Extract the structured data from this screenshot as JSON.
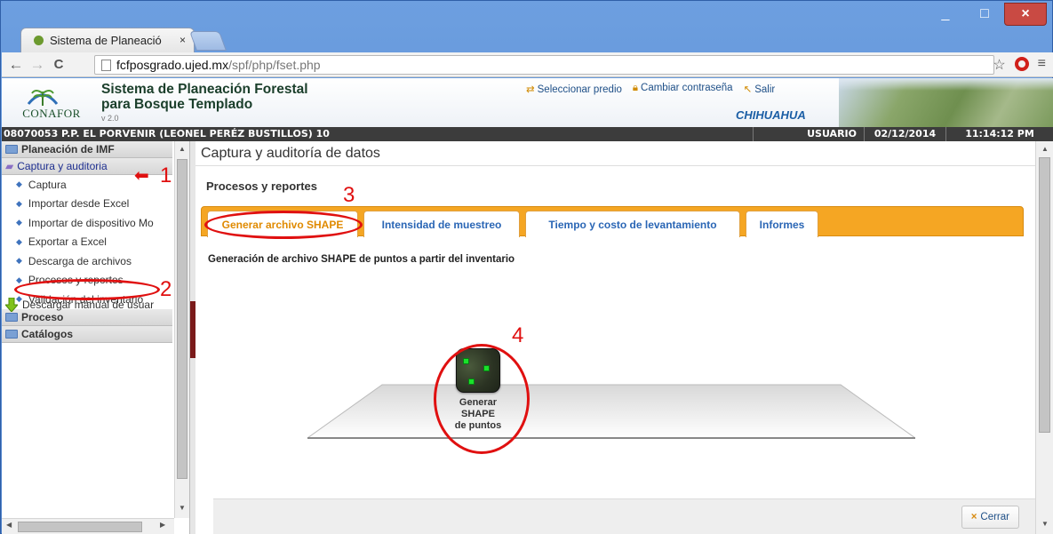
{
  "browser": {
    "tab_title": "Sistema de Planeació",
    "tab_close": "×",
    "url_host": "fcfposgrado.ujed.mx",
    "url_path": "/spf/php/fset.php",
    "window_minimize": "_",
    "window_maximize": "□",
    "window_close": "×",
    "nav_back": "←",
    "nav_forward": "→",
    "nav_reload": "C",
    "bookmark_star": "☆",
    "menu": "≡"
  },
  "header": {
    "logo_text": "CONAFOR",
    "system_title_line1": "Sistema de Planeación Forestal",
    "system_title_line2": "para Bosque Templado",
    "version": "v 2.0",
    "links": [
      {
        "icon": "swap-icon",
        "label": "Seleccionar predio"
      },
      {
        "icon": "lock-icon",
        "label": "Cambiar contraseña"
      },
      {
        "icon": "exit-icon",
        "label": "Salir"
      }
    ],
    "state": "CHIHUAHUA"
  },
  "status": {
    "predio": "08070053 P.P. EL PORVENIR (LEONEL PERÉZ BUSTILLOS) 10",
    "user": "USUARIO",
    "date": "02/12/2014",
    "time": "11:14:12 PM"
  },
  "sidebar": {
    "groups": [
      {
        "label": "Planeación de IMF"
      },
      {
        "label": "Captura y auditoria"
      },
      {
        "label": "Proceso"
      },
      {
        "label": "Catálogos"
      }
    ],
    "items": [
      {
        "label": "Captura"
      },
      {
        "label": "Importar desde Excel"
      },
      {
        "label": "Importar de dispositivo Mo"
      },
      {
        "label": "Exportar a Excel"
      },
      {
        "label": "Descarga de archivos"
      },
      {
        "label": "Procesos y reportes"
      },
      {
        "label": "Validación del inventario"
      }
    ],
    "download_label": "Descargar manual de usuar"
  },
  "main": {
    "title": "Captura y auditoría de datos",
    "section_title": "Procesos y reportes",
    "tabs": [
      {
        "label": "Generar archivo SHAPE"
      },
      {
        "label": "Intensidad de muestreo"
      },
      {
        "label": "Tiempo y costo de levantamiento"
      },
      {
        "label": "Informes"
      }
    ],
    "description": "Generación de archivo SHAPE de puntos a partir del inventario",
    "action_label_line1": "Generar",
    "action_label_line2": "SHAPE",
    "action_label_line3": "de puntos",
    "close_label": "Cerrar"
  },
  "annotations": {
    "n1": "1",
    "n2": "2",
    "n3": "3",
    "n4": "4",
    "arrow": "⬅"
  },
  "colors": {
    "accent_orange": "#f5a623",
    "annotation_red": "#e01010",
    "link_blue": "#2a66b5"
  }
}
